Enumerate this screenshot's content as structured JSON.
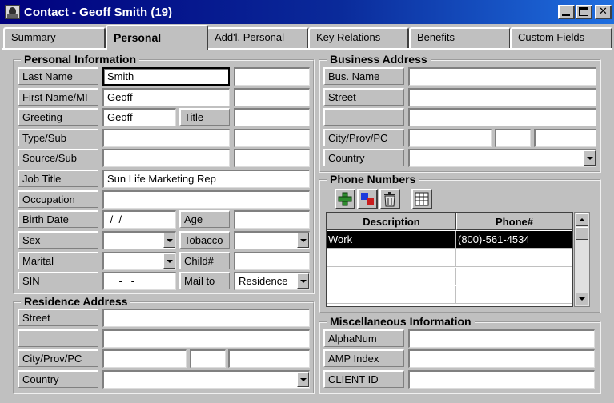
{
  "window": {
    "title": "Contact - Geoff Smith (19)",
    "minimize": "_",
    "maximize": "□",
    "close": "✕"
  },
  "tabs": [
    "Summary",
    "Personal",
    "Add'l. Personal",
    "Key Relations",
    "Benefits",
    "Custom Fields"
  ],
  "active_tab": "Personal",
  "personal": {
    "title": "Personal Information",
    "last_name_label": "Last Name",
    "last_name": "Smith",
    "last_name_extra": "",
    "first_name_label": "First Name/MI",
    "first_name": "Geoff",
    "middle_initial": "",
    "greeting_label": "Greeting",
    "greeting": "Geoff",
    "title_label": "Title",
    "title_value": "",
    "type_label": "Type/Sub",
    "type_value": "",
    "type_sub": "",
    "source_label": "Source/Sub",
    "source_value": "",
    "source_sub": "",
    "job_title_label": "Job Title",
    "job_title": "Sun Life Marketing Rep",
    "occupation_label": "Occupation",
    "occupation": "",
    "birth_date_label": "Birth Date",
    "birth_date": " /  /",
    "age_label": "Age",
    "age": "",
    "sex_label": "Sex",
    "sex": "",
    "tobacco_label": "Tobacco",
    "tobacco": "",
    "marital_label": "Marital",
    "marital": "",
    "child_label": "Child#",
    "child": "",
    "sin_label": "SIN",
    "sin": "    -   -",
    "mail_to_label": "Mail to",
    "mail_to": "Residence"
  },
  "residence": {
    "title": "Residence Address",
    "street_label": "Street",
    "street": "",
    "street2_label": "",
    "street2": "",
    "city_label": "City/Prov/PC",
    "city": "",
    "prov": "",
    "pc": "",
    "country_label": "Country",
    "country": ""
  },
  "business": {
    "title": "Business Address",
    "bus_name_label": "Bus. Name",
    "bus_name": "",
    "street_label": "Street",
    "street": "",
    "street2_label": "",
    "street2": "",
    "city_label": "City/Prov/PC",
    "city": "",
    "prov": "",
    "pc": "",
    "country_label": "Country",
    "country": ""
  },
  "phones": {
    "title": "Phone Numbers",
    "toolbar_icons": [
      "add-icon",
      "color-icon",
      "trash-icon",
      "grid-icon"
    ],
    "columns": [
      "Description",
      "Phone#"
    ],
    "rows": [
      {
        "description": "Work",
        "phone": "(800)-561-4534"
      }
    ]
  },
  "misc": {
    "title": "Miscellaneous Information",
    "alphanum_label": "AlphaNum",
    "alphanum": "",
    "amp_label": "AMP Index",
    "amp": "",
    "client_id_label": "CLIENT ID",
    "client_id": ""
  },
  "colors": {
    "title_bar_start": "#00007e",
    "title_bar_end": "#1f6fe0",
    "face": "#c0c0c0",
    "selected_row": "#000000"
  }
}
